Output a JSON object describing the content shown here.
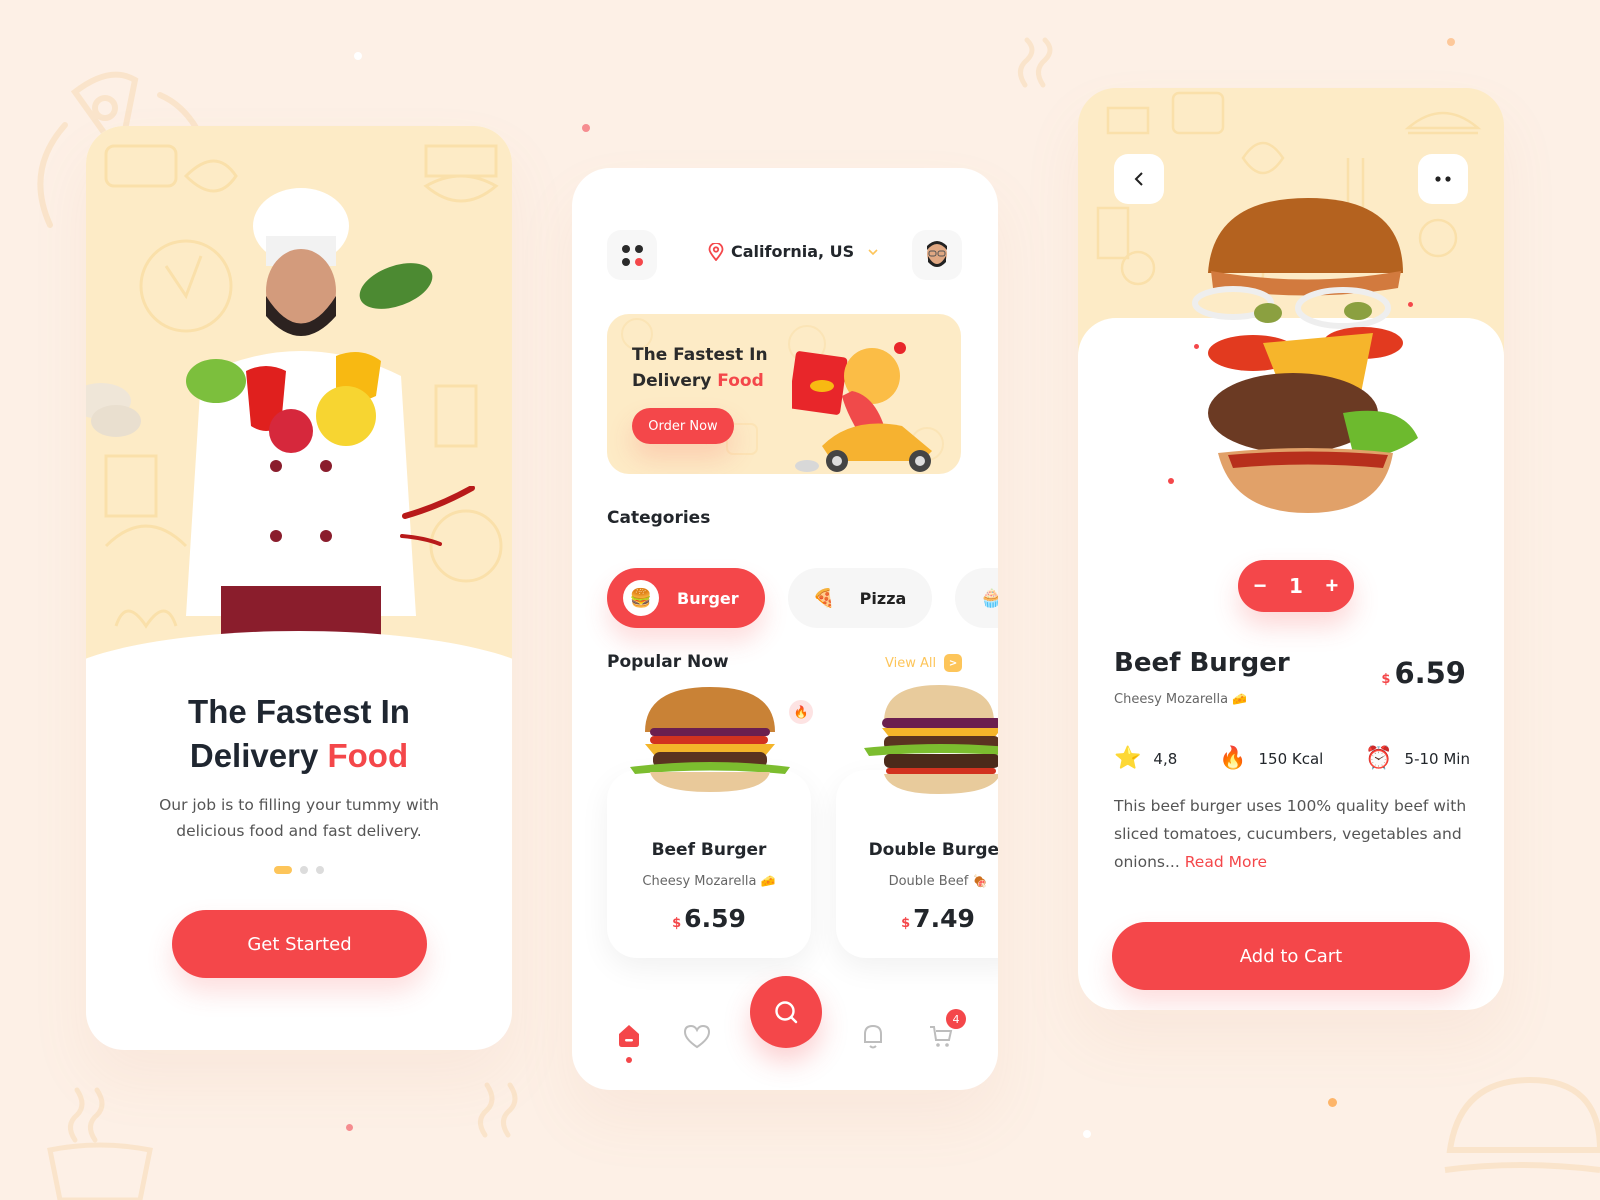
{
  "screen_onboarding": {
    "title_line1": "The Fastest In",
    "title_line2_prefix": "Delivery ",
    "title_line2_accent": "Food",
    "subtitle": "Our job is to filling your tummy with delicious food and fast delivery.",
    "pager": {
      "total": 3,
      "active_index": 0
    },
    "cta_label": "Get Started"
  },
  "screen_home": {
    "header": {
      "menu_icon": "grid-dots-icon",
      "location": "California, US",
      "location_icon": "map-pin-icon",
      "dropdown_icon": "chevron-down-icon",
      "avatar": "user-avatar"
    },
    "banner": {
      "title_line1": "The Fastest In",
      "title_line2_prefix": "Delivery ",
      "title_line2_accent": "Food",
      "button_label": "Order Now"
    },
    "categories_title": "Categories",
    "categories": [
      {
        "label": "Burger",
        "icon": "🍔",
        "active": true
      },
      {
        "label": "Pizza",
        "icon": "🍕",
        "active": false
      },
      {
        "label": "",
        "icon": "🧁",
        "active": false
      }
    ],
    "popular_title": "Popular Now",
    "view_all_label": "View All",
    "popular_items": [
      {
        "name": "Beef Burger",
        "subtitle": "Cheesy Mozarella",
        "sub_icon": "🧀",
        "currency": "$",
        "price": "6.59",
        "badge_icon": "🔥"
      },
      {
        "name": "Double Burger",
        "subtitle": "Double Beef",
        "sub_icon": "🍖",
        "currency": "$",
        "price": "7.49"
      }
    ],
    "bottom_nav": {
      "items": [
        "home-icon",
        "heart-icon",
        "search-icon",
        "bell-icon",
        "cart-icon"
      ],
      "active": "home-icon",
      "cart_badge": "4"
    }
  },
  "screen_detail": {
    "back_icon": "chevron-left-icon",
    "more_icon": "more-dots-icon",
    "quantity": "1",
    "minus_label": "−",
    "plus_label": "+",
    "name": "Beef Burger",
    "subtitle": "Cheesy Mozarella",
    "sub_icon": "🧀",
    "currency": "$",
    "price": "6.59",
    "stats": [
      {
        "icon": "⭐",
        "value": "4,8"
      },
      {
        "icon": "🔥",
        "value": "150 Kcal"
      },
      {
        "icon": "⏰",
        "value": "5-10 Min"
      }
    ],
    "description": "This beef burger uses 100% quality beef with sliced tomatoes, cucumbers, vegetables and onions... ",
    "read_more_label": "Read More",
    "cta_label": "Add to Cart"
  },
  "colors": {
    "accent_red": "#f4474a",
    "accent_yellow": "#fdc55a",
    "hero_bg": "#fdebc6",
    "page_bg": "#fdf0e6",
    "text_dark": "#22262b"
  }
}
